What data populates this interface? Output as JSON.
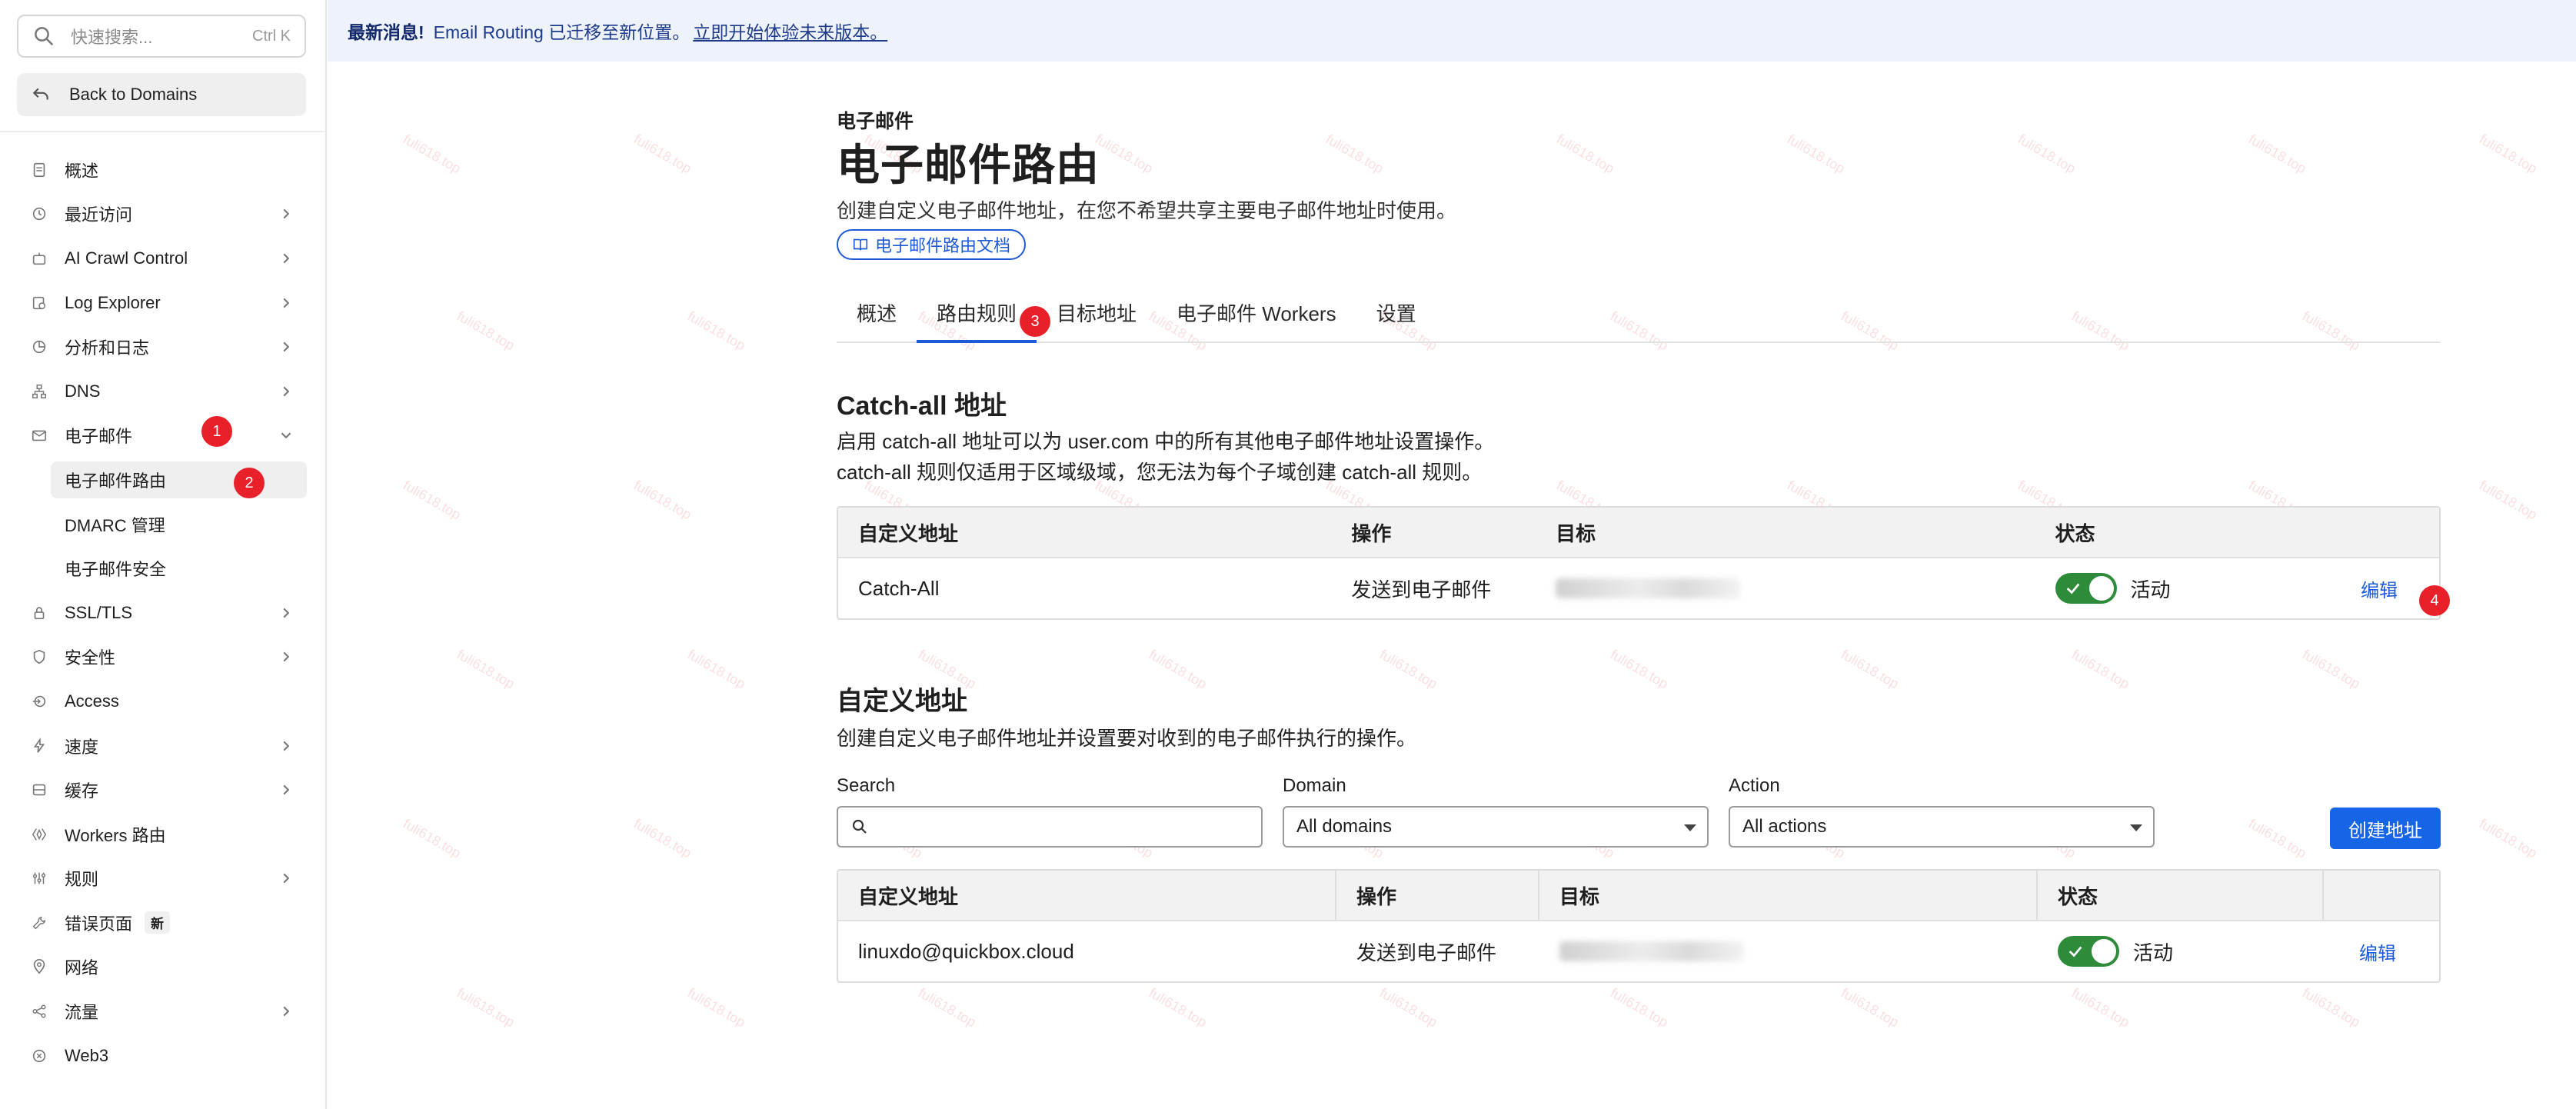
{
  "sidebar": {
    "search_placeholder": "快速搜索...",
    "search_shortcut": "Ctrl K",
    "back_label": "Back to Domains",
    "items": [
      {
        "label": "概述",
        "icon": "document-icon",
        "chevron": false
      },
      {
        "label": "最近访问",
        "icon": "history-icon",
        "chevron": true
      },
      {
        "label": "AI Crawl Control",
        "icon": "robot-icon",
        "chevron": true
      },
      {
        "label": "Log Explorer",
        "icon": "log-icon",
        "chevron": true
      },
      {
        "label": "分析和日志",
        "icon": "chart-pie-icon",
        "chevron": true
      },
      {
        "label": "DNS",
        "icon": "network-icon",
        "chevron": true
      },
      {
        "label": "电子邮件",
        "icon": "mail-icon",
        "chevron": "down"
      },
      {
        "label": "电子邮件路由",
        "sub": true,
        "active": true
      },
      {
        "label": "DMARC 管理",
        "sub": true
      },
      {
        "label": "电子邮件安全",
        "sub": true
      },
      {
        "label": "SSL/TLS",
        "icon": "lock-icon",
        "chevron": true
      },
      {
        "label": "安全性",
        "icon": "shield-icon",
        "chevron": true
      },
      {
        "label": "Access",
        "icon": "access-icon",
        "chevron": false
      },
      {
        "label": "速度",
        "icon": "bolt-icon",
        "chevron": true
      },
      {
        "label": "缓存",
        "icon": "cache-icon",
        "chevron": true
      },
      {
        "label": "Workers 路由",
        "icon": "workers-icon",
        "chevron": false
      },
      {
        "label": "规则",
        "icon": "rules-icon",
        "chevron": true
      },
      {
        "label": "错误页面",
        "icon": "wrench-icon",
        "chevron": false,
        "badge": "新"
      },
      {
        "label": "网络",
        "icon": "location-icon",
        "chevron": false
      },
      {
        "label": "流量",
        "icon": "traffic-icon",
        "chevron": true
      },
      {
        "label": "Web3",
        "icon": "web3-icon",
        "chevron": false
      }
    ]
  },
  "banner": {
    "prefix": "最新消息!",
    "text": "Email Routing 已迁移至新位置。",
    "link": "立即开始体验未来版本。"
  },
  "watermark": "fuli618.top",
  "steps": [
    "1",
    "2",
    "3",
    "4"
  ],
  "header": {
    "eyebrow": "电子邮件",
    "title": "电子邮件路由",
    "description": "创建自定义电子邮件地址，在您不希望共享主要电子邮件地址时使用。",
    "doc_link": "电子邮件路由文档"
  },
  "tabs": [
    "概述",
    "路由规则",
    "目标地址",
    "电子邮件 Workers",
    "设置"
  ],
  "catch_all": {
    "title": "Catch-all 地址",
    "desc_line1": "启用 catch-all 地址可以为 user.com 中的所有其他电子邮件地址设置操作。",
    "desc_line2": "catch-all 规则仅适用于区域级域，您无法为每个子域创建 catch-all 规则。",
    "columns": [
      "自定义地址",
      "操作",
      "目标",
      "状态"
    ],
    "row": {
      "address": "Catch-All",
      "action": "发送到电子邮件",
      "status": "活动",
      "edit": "编辑"
    }
  },
  "custom": {
    "title": "自定义地址",
    "desc": "创建自定义电子邮件地址并设置要对收到的电子邮件执行的操作。",
    "search_label": "Search",
    "domain_label": "Domain",
    "domain_value": "All domains",
    "action_label": "Action",
    "action_value": "All actions",
    "create_button": "创建地址",
    "columns": [
      "自定义地址",
      "操作",
      "目标",
      "状态"
    ],
    "row": {
      "address": "linuxdo@quickbox.cloud",
      "action": "发送到电子邮件",
      "status": "活动",
      "edit": "编辑"
    }
  },
  "colors": {
    "accent": "#1f5ad6",
    "toggle_on": "#2e8b3a",
    "step_badge": "#e8202a",
    "banner_bg": "#eef3fb"
  }
}
